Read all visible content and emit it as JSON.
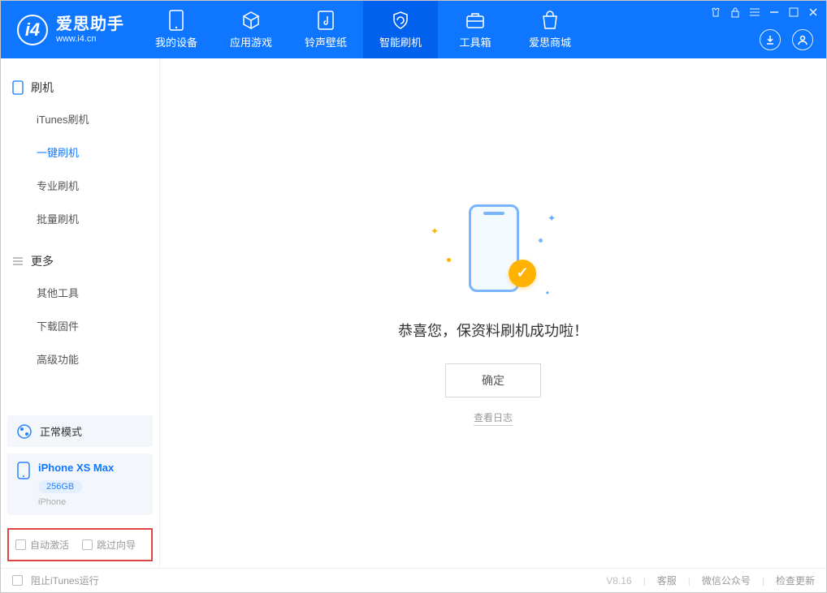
{
  "app": {
    "title": "爱思助手",
    "subtitle": "www.i4.cn"
  },
  "tabs": [
    {
      "label": "我的设备"
    },
    {
      "label": "应用游戏"
    },
    {
      "label": "铃声壁纸"
    },
    {
      "label": "智能刷机"
    },
    {
      "label": "工具箱"
    },
    {
      "label": "爱思商城"
    }
  ],
  "sidebar": {
    "section1": {
      "title": "刷机",
      "items": [
        "iTunes刷机",
        "一键刷机",
        "专业刷机",
        "批量刷机"
      ]
    },
    "section2": {
      "title": "更多",
      "items": [
        "其他工具",
        "下载固件",
        "高级功能"
      ]
    }
  },
  "mode_block": {
    "label": "正常模式"
  },
  "device": {
    "name": "iPhone XS Max",
    "storage": "256GB",
    "type": "iPhone"
  },
  "checkboxes": {
    "auto_activate": "自动激活",
    "skip_guide": "跳过向导"
  },
  "main": {
    "success": "恭喜您，保资料刷机成功啦！",
    "ok": "确定",
    "view_log": "查看日志"
  },
  "footer": {
    "block_itunes": "阻止iTunes运行",
    "version": "V8.16",
    "links": [
      "客服",
      "微信公众号",
      "检查更新"
    ]
  }
}
